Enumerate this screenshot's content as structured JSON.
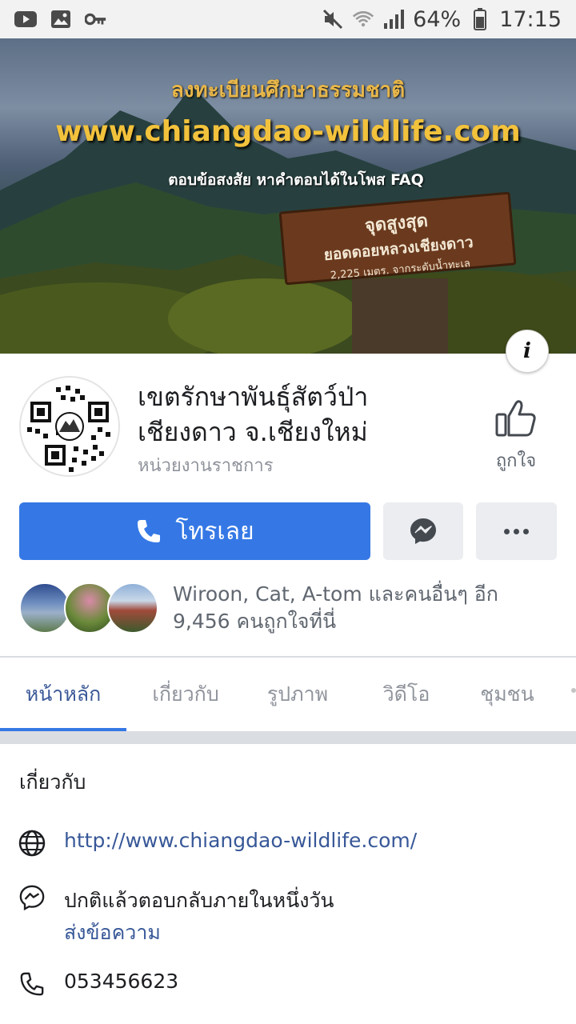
{
  "status_bar": {
    "battery": "64%",
    "time": "17:15",
    "icons": [
      "youtube-icon",
      "gallery-icon",
      "key-icon",
      "mute-icon",
      "wifi-icon",
      "signal-icon",
      "battery-icon"
    ]
  },
  "cover": {
    "line1": "ลงทะเบียนศึกษาธรรมชาติ",
    "line2": "www.chiangdao-wildlife.com",
    "line3": "ตอบข้อสงสัย หาคำตอบได้ในโพส FAQ",
    "sign_line1": "จุดสูงสุด",
    "sign_line2": "ยอดดอยหลวงเชียงดาว",
    "sign_line3": "2,225 เมตร. จากระดับน้ำทะเล",
    "info_label": "i"
  },
  "profile": {
    "name": "เขตรักษาพันธุ์สัตว์ป่า เชียงดาว จ.เชียงใหม่",
    "category": "หน่วยงานราชการ",
    "like_label": "ถูกใจ"
  },
  "actions": {
    "call_label": "โทรเลย"
  },
  "friends": {
    "text": "Wiroon, Cat, A-tom และคนอื่นๆ อีก 9,456 คนถูกใจที่นี่"
  },
  "tabs": [
    {
      "label": "หน้าหลัก"
    },
    {
      "label": "เกี่ยวกับ"
    },
    {
      "label": "รูปภาพ"
    },
    {
      "label": "วิดีโอ"
    },
    {
      "label": "ชุมชน"
    }
  ],
  "about": {
    "title": "เกี่ยวกับ",
    "website": "http://www.chiangdao-wildlife.com/",
    "response": "ปกติแล้วตอบกลับภายในหนึ่งวัน",
    "send_message": "ส่งข้อความ",
    "phone": "053456623"
  },
  "colors": {
    "primary": "#3578e5",
    "link": "#385898",
    "tab_active": "#3b5998",
    "muted": "#90949c"
  }
}
